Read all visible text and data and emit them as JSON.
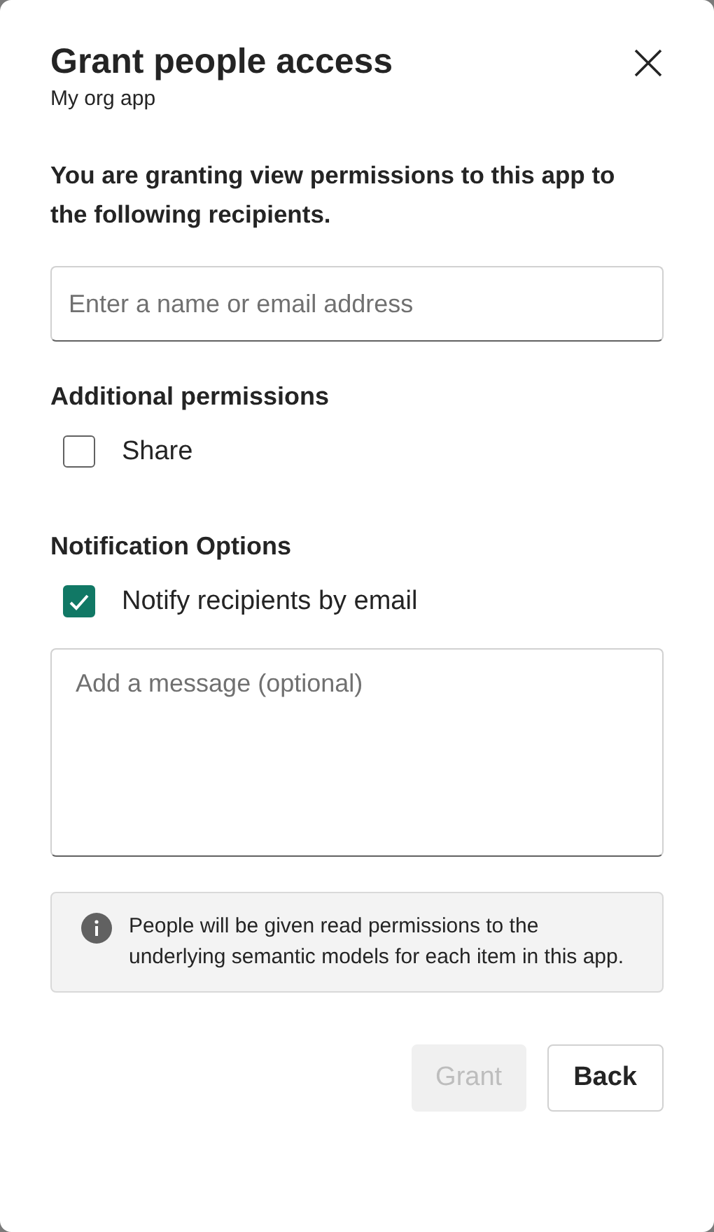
{
  "dialog": {
    "title": "Grant people access",
    "subtitle": "My org app",
    "description": "You are granting view permissions to this app to the following recipients.",
    "recipient_field": {
      "placeholder": "Enter a name or email address"
    },
    "sections": [
      {
        "heading": "Additional permissions",
        "options": [
          {
            "label": "Share",
            "checked": false
          }
        ]
      },
      {
        "heading": "Notification Options",
        "options": [
          {
            "label": "Notify recipients by email",
            "checked": true
          }
        ]
      }
    ],
    "message_field": {
      "placeholder": "Add a message (optional)"
    },
    "info": "People will be given read permissions to the underlying semantic models for each item in this app.",
    "buttons": [
      {
        "label": "Grant",
        "disabled": true
      },
      {
        "label": "Back",
        "disabled": false
      }
    ]
  }
}
